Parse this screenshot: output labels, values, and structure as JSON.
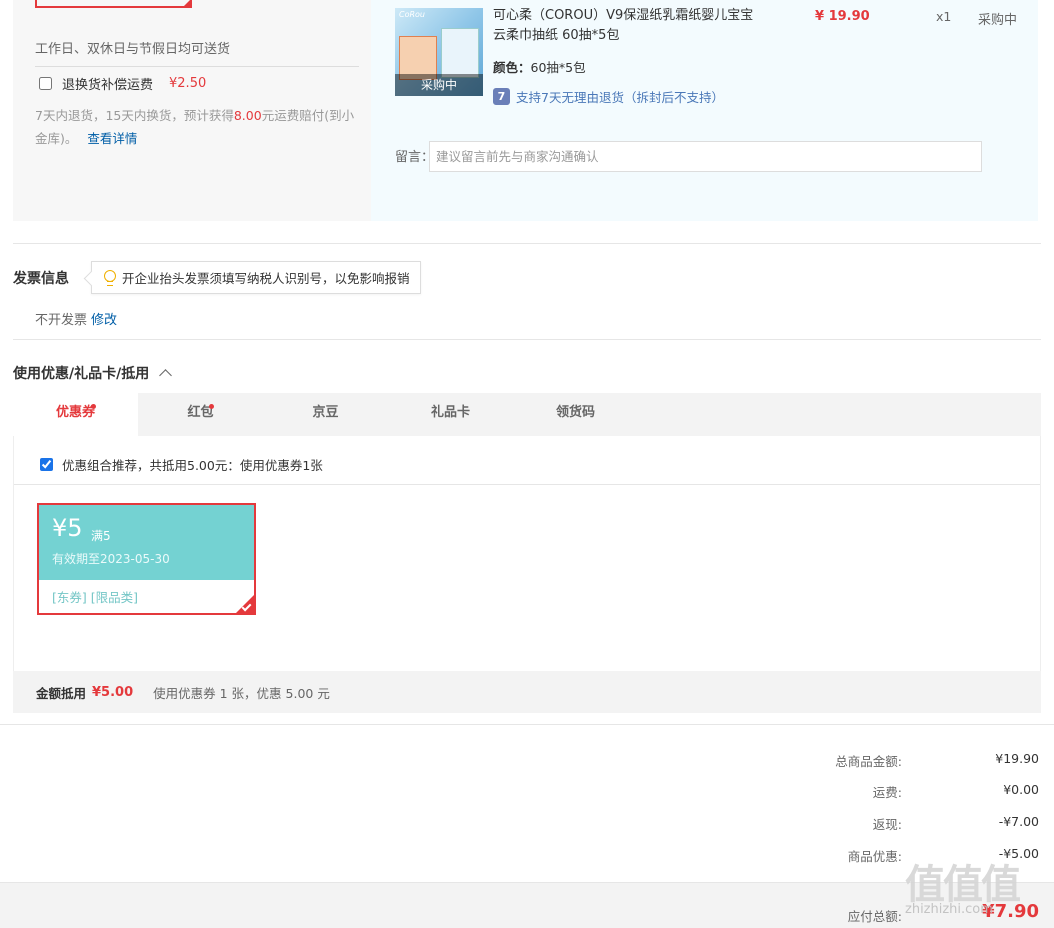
{
  "left": {
    "delivery_note": "工作日、双休日与节假日均可送货",
    "return_label": "退换货补偿运费",
    "return_price": "¥2.50",
    "return_desc_a": "7天内退货，15天内换货，预计获得",
    "return_desc_amount": "8.00",
    "return_desc_b": "元运费赔付(到小金库)。",
    "return_link": "查看详情"
  },
  "product": {
    "thumb_status": "采购中",
    "name": "可心柔（COROU）V9保湿纸乳霜纸婴儿宝宝云柔巾抽纸 60抽*5包",
    "price": "¥ 19.90",
    "qty": "x1",
    "state": "采购中",
    "color_label": "颜色：",
    "color_value": "60抽*5包",
    "return_icon": "7",
    "return_text": "支持7天无理由退货（拆封后不支持）"
  },
  "message": {
    "label": "留言：",
    "placeholder": "建议留言前先与商家沟通确认"
  },
  "invoice": {
    "title": "发票信息",
    "tip": "开企业抬头发票须填写纳税人识别号，以免影响报销",
    "value": "不开发票",
    "edit": "修改"
  },
  "coupons": {
    "title": "使用优惠/礼品卡/抵用",
    "tabs": [
      {
        "label": "优惠券",
        "dot": true
      },
      {
        "label": "红包",
        "dot": true
      },
      {
        "label": "京豆",
        "dot": false
      },
      {
        "label": "礼品卡",
        "dot": false
      },
      {
        "label": "领货码",
        "dot": false
      }
    ],
    "recommend": "优惠组合推荐，共抵用5.00元：使用优惠券1张",
    "card": {
      "amount": "¥5",
      "condition": "满5",
      "valid": "有效期至2023-05-30",
      "tags": "[东券] [限品类]"
    },
    "summary_label": "金额抵用",
    "summary_amount": "¥5.00",
    "summary_text": "使用优惠券 1 张，优惠 5.00 元"
  },
  "totals": {
    "rows": [
      {
        "label": "总商品金额:",
        "value": "¥19.90"
      },
      {
        "label": "运费:",
        "value": "¥0.00"
      },
      {
        "label": "返现:",
        "value": "-¥7.00"
      },
      {
        "label": "商品优惠:",
        "value": "-¥5.00"
      }
    ],
    "pay_label": "应付总额:",
    "pay_value": "¥7.90"
  },
  "watermark": {
    "logo": "值值值",
    "text": "zhizhizhi.com"
  },
  "colors": {
    "accent_red": "#e4393c",
    "coupon_teal": "#74d2d2",
    "link_blue": "#005ea7"
  }
}
